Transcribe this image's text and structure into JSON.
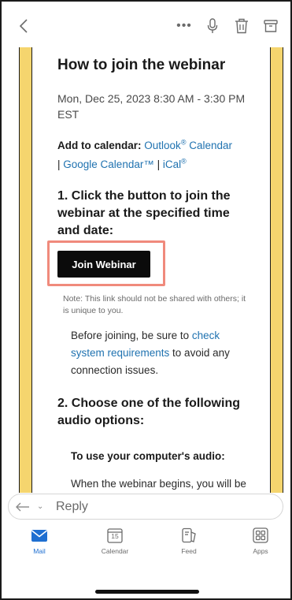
{
  "toolbar": {
    "back": "back-icon",
    "more": "•••",
    "mic": "microphone-icon",
    "trash": "trash-icon",
    "archive": "archive-icon"
  },
  "email": {
    "title": "How to join the webinar",
    "date": "Mon, Dec 25, 2023 8:30 AM - 3:30 PM EST",
    "add_to_calendar_label": "Add to calendar:",
    "outlook_link": "Outlook",
    "outlook_sup": "®",
    "outlook_calendar": " Calendar",
    "separator1": " | ",
    "google_link": "Google Calendar™",
    "separator2": " | ",
    "ical_link": "iCal",
    "ical_sup": "®",
    "step1": "1. Click the button to join the webinar at the specified time and date:",
    "join_button": "Join Webinar",
    "note": "Note: This link should not be shared with others; it is unique to you.",
    "before_prefix": "Before joining, be sure to ",
    "check_link": "check system requirements",
    "before_suffix": " to avoid any connection issues.",
    "step2": "2. Choose one of the following audio options:",
    "audio_subhead": "To use your computer's audio:",
    "audio_text": "When the webinar begins, you will be connected to audio using your"
  },
  "reply": {
    "label": "Reply",
    "chevron": "⌄"
  },
  "nav": {
    "items": [
      {
        "label": "Mail",
        "icon": "mail-icon",
        "active": true
      },
      {
        "label": "Calendar",
        "icon": "calendar-icon",
        "date": "15",
        "active": false
      },
      {
        "label": "Feed",
        "icon": "feed-icon",
        "active": false
      },
      {
        "label": "Apps",
        "icon": "apps-icon",
        "active": false
      }
    ]
  },
  "colors": {
    "accent": "#1f6fd1",
    "link": "#1f72b0",
    "stripe": "#f5d56e",
    "highlight": "#f08a7c"
  }
}
